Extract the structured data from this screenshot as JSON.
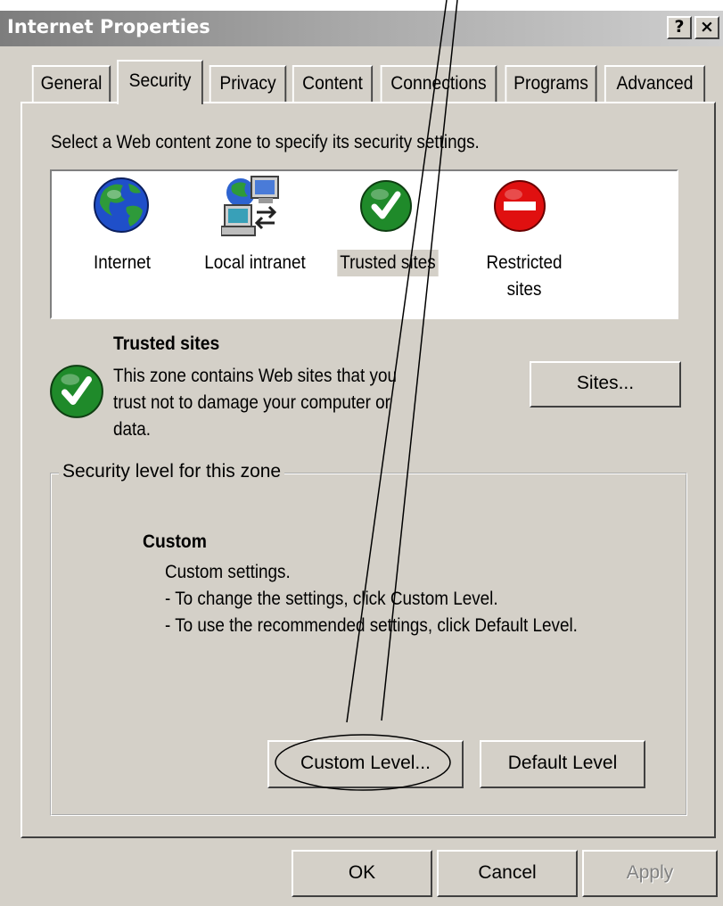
{
  "window": {
    "title": "Internet Properties",
    "help_button": "?",
    "close_button": "×"
  },
  "tabs": [
    {
      "label": "General"
    },
    {
      "label": "Security",
      "active": true
    },
    {
      "label": "Privacy"
    },
    {
      "label": "Content"
    },
    {
      "label": "Connections"
    },
    {
      "label": "Programs"
    },
    {
      "label": "Advanced"
    }
  ],
  "security": {
    "instruction": "Select a Web content zone to specify its security settings.",
    "zones": [
      {
        "label": "Internet",
        "icon": "globe-icon"
      },
      {
        "label": "Local intranet",
        "icon": "network-computers-icon"
      },
      {
        "label": "Trusted sites",
        "icon": "green-check-icon",
        "selected": true
      },
      {
        "label_line1": "Restricted",
        "label_line2": "sites",
        "icon": "red-no-entry-icon"
      }
    ],
    "zone_info": {
      "title": "Trusted sites",
      "line1": "This zone contains Web sites that you",
      "line2": "trust not to damage your computer or",
      "line3": "data.",
      "sites_button": "Sites..."
    },
    "level_group": {
      "legend": "Security level for this zone",
      "level_name": "Custom",
      "line1": "Custom settings.",
      "line2": "- To change the settings, click Custom Level.",
      "line3": "- To use the recommended settings, click Default Level.",
      "custom_level_button": "Custom Level...",
      "default_level_button": "Default Level"
    }
  },
  "footer": {
    "ok": "OK",
    "cancel": "Cancel",
    "apply": "Apply"
  },
  "colors": {
    "face": "#d4d0c8",
    "check_green": "#1f8a2a",
    "stop_red": "#e01010"
  }
}
